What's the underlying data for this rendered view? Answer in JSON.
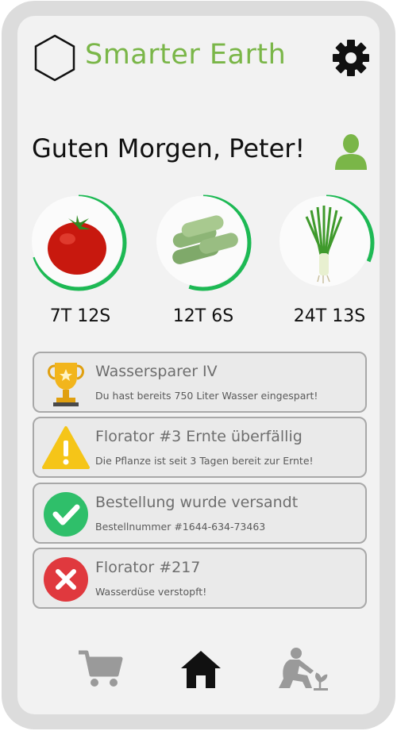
{
  "header": {
    "app_title": "Smarter Earth",
    "logo_icon": "hexagon-logo-icon",
    "settings_icon": "gear-icon"
  },
  "greeting": {
    "text": "Guten Morgen, Peter!",
    "avatar_icon": "user-icon"
  },
  "plants": [
    {
      "name": "Tomate",
      "image_icon": "tomato-icon",
      "time_left": "7T 12S",
      "progress": 0.7
    },
    {
      "name": "Zucchini",
      "image_icon": "zucchini-icon",
      "time_left": "12T 6S",
      "progress": 0.55
    },
    {
      "name": "Frühlingszwiebel",
      "image_icon": "spring-onion-icon",
      "time_left": "24T 13S",
      "progress": 0.3
    }
  ],
  "notifications": [
    {
      "title": "Wassersparer IV",
      "subtitle": "Du hast bereits 750 Liter Wasser eingespart!",
      "icon": "trophy-icon"
    },
    {
      "title": "Florator #3 Ernte überfällig",
      "subtitle": "Die Pflanze ist seit 3 Tagen bereit zur Ernte!",
      "icon": "warning-icon"
    },
    {
      "title": "Bestellung wurde versandt",
      "subtitle": "Bestellnummer #1644-634-73463",
      "icon": "check-icon"
    },
    {
      "title": "Florator #217",
      "subtitle": "Wasserdüse verstopft!",
      "icon": "error-icon"
    }
  ],
  "bottom_nav": {
    "items": [
      {
        "icon": "cart-icon",
        "active": false
      },
      {
        "icon": "home-icon",
        "active": true
      },
      {
        "icon": "gardening-icon",
        "active": false
      }
    ]
  },
  "colors": {
    "brand_green": "#7ab648",
    "progress_green": "#1db954",
    "card_border": "#a8a8a8"
  }
}
